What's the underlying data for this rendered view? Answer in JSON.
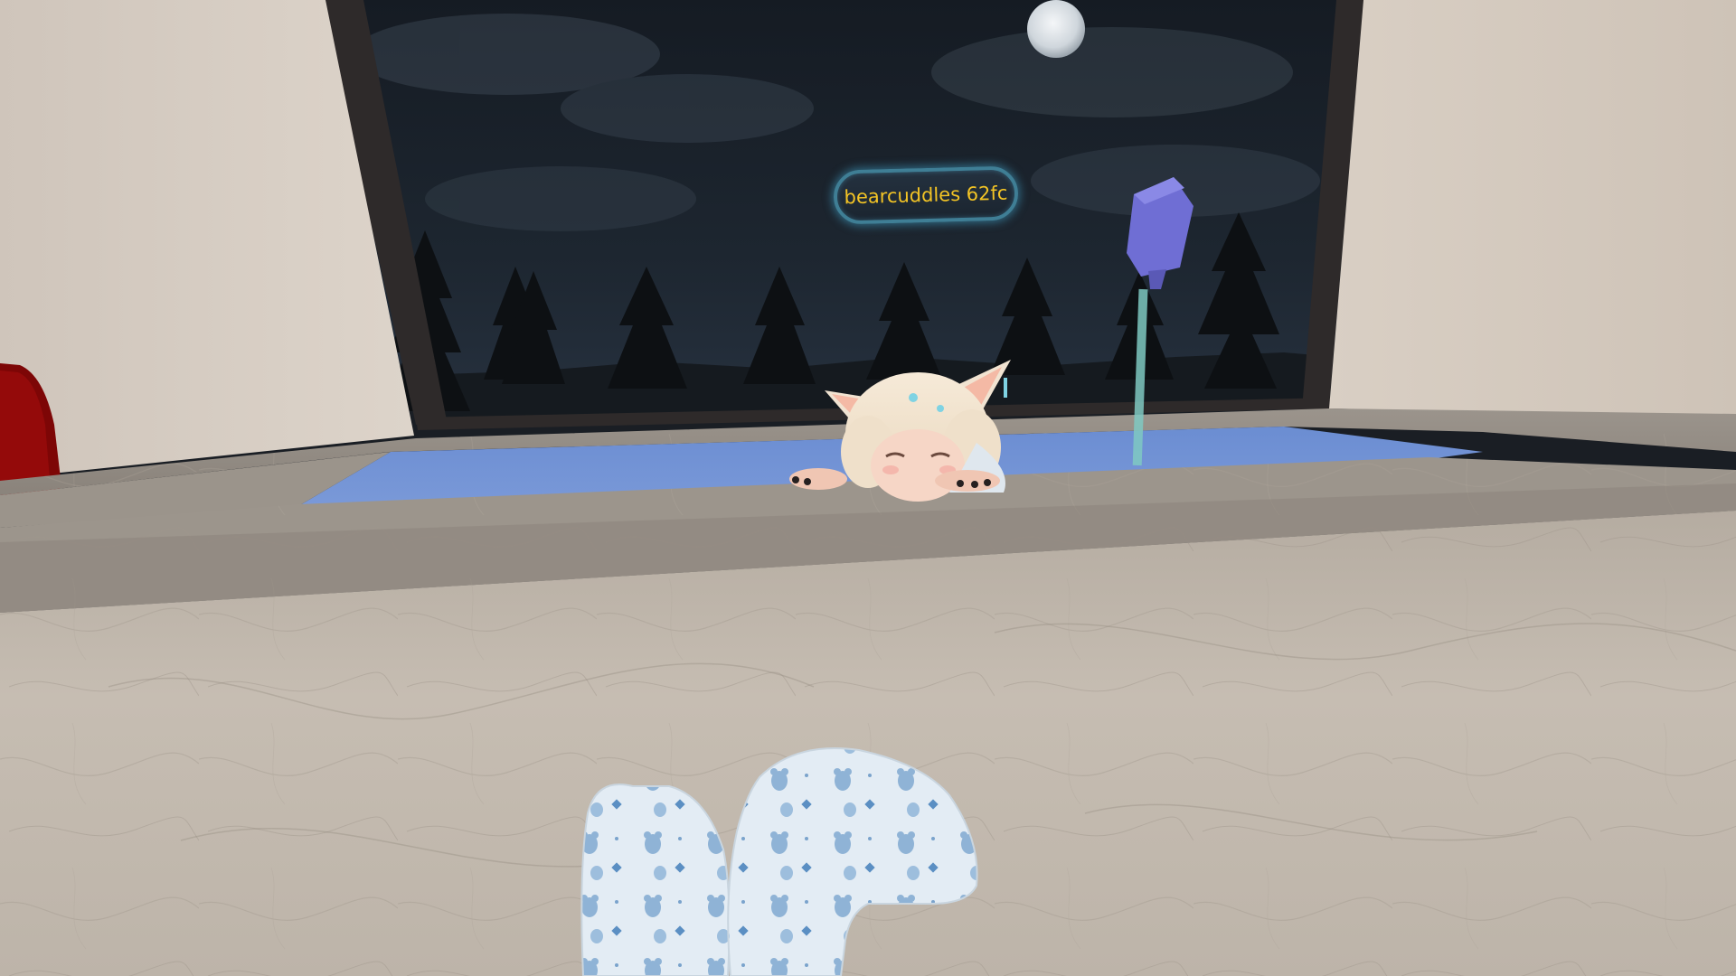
{
  "scene": {
    "player_nameplate": {
      "name": "bearcuddles 62fc"
    },
    "colors": {
      "wall": "#d6cdc3",
      "window_frame": "#2e2a2a",
      "night_sky": "#1c2530",
      "water": "#6e8fd0",
      "marble": "#a8a095",
      "nameplate_text": "#f3c425",
      "nameplate_border": "#3f7e95",
      "faucet": "#6f6ed4"
    }
  }
}
